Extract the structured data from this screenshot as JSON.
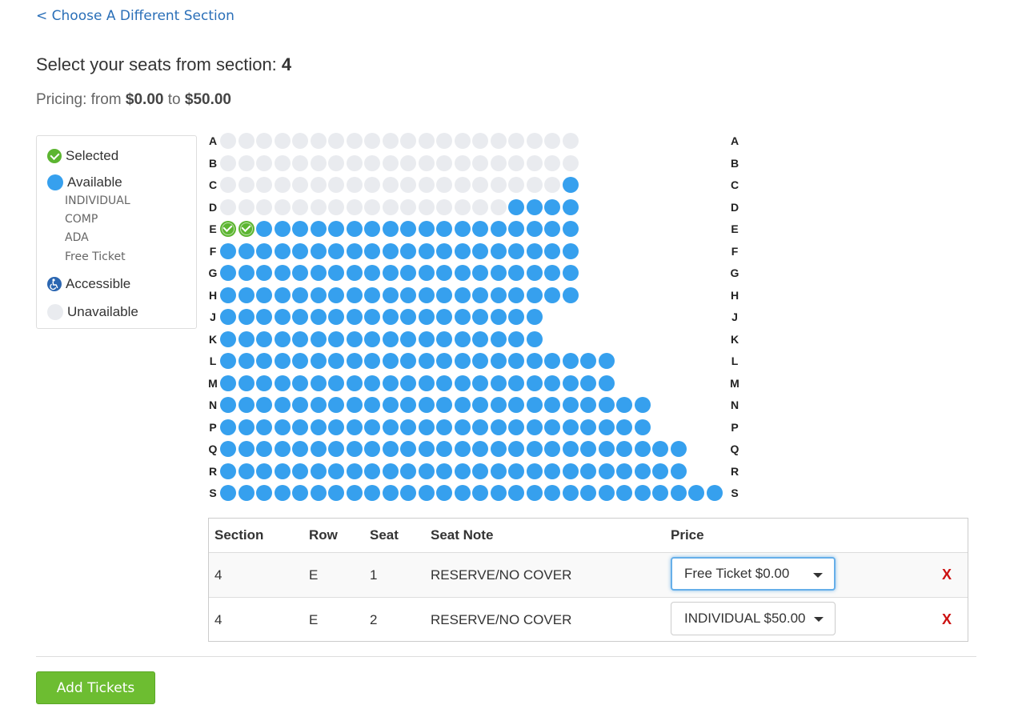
{
  "nav": {
    "back_link": "< Choose A Different Section"
  },
  "header": {
    "title_prefix": "Select your seats from section:",
    "section": "4",
    "pricing_prefix": "Pricing: from",
    "price_min": "$0.00",
    "pricing_mid": "to",
    "price_max": "$50.00"
  },
  "legend": {
    "selected": "Selected",
    "available": "Available",
    "price_levels": [
      "INDIVIDUAL",
      "COMP",
      "ADA",
      "Free Ticket"
    ],
    "accessible": "Accessible",
    "unavailable": "Unavailable"
  },
  "colors": {
    "available": "#36a0ee",
    "selected": "#5cb531",
    "unavailable": "#e9ebef",
    "accessible": "#2b66b1",
    "link": "#2a6fb8",
    "remove": "#cc1111",
    "add_button": "#6dbd31"
  },
  "seatmap": {
    "rows": [
      {
        "label": "A",
        "count": 20,
        "unavailable": 20,
        "selected": []
      },
      {
        "label": "B",
        "count": 20,
        "unavailable": 20,
        "selected": []
      },
      {
        "label": "C",
        "count": 20,
        "unavailable": 19,
        "selected": []
      },
      {
        "label": "D",
        "count": 20,
        "unavailable": 16,
        "selected": []
      },
      {
        "label": "E",
        "count": 20,
        "unavailable": 0,
        "selected": [
          1,
          2
        ]
      },
      {
        "label": "F",
        "count": 20,
        "unavailable": 0,
        "selected": []
      },
      {
        "label": "G",
        "count": 20,
        "unavailable": 0,
        "selected": []
      },
      {
        "label": "H",
        "count": 20,
        "unavailable": 0,
        "selected": []
      },
      {
        "label": "J",
        "count": 18,
        "unavailable": 0,
        "selected": []
      },
      {
        "label": "K",
        "count": 18,
        "unavailable": 0,
        "selected": []
      },
      {
        "label": "L",
        "count": 22,
        "unavailable": 0,
        "selected": []
      },
      {
        "label": "M",
        "count": 22,
        "unavailable": 0,
        "selected": []
      },
      {
        "label": "N",
        "count": 24,
        "unavailable": 0,
        "selected": []
      },
      {
        "label": "P",
        "count": 24,
        "unavailable": 0,
        "selected": []
      },
      {
        "label": "Q",
        "count": 26,
        "unavailable": 0,
        "selected": []
      },
      {
        "label": "R",
        "count": 26,
        "unavailable": 0,
        "selected": []
      },
      {
        "label": "S",
        "count": 28,
        "unavailable": 0,
        "selected": []
      }
    ]
  },
  "tickets": {
    "headers": {
      "section": "Section",
      "row": "Row",
      "seat": "Seat",
      "note": "Seat Note",
      "price": "Price"
    },
    "rows": [
      {
        "section": "4",
        "row": "E",
        "seat": "1",
        "note": "RESERVE/NO COVER",
        "price": "Free Ticket $0.00",
        "remove": "X"
      },
      {
        "section": "4",
        "row": "E",
        "seat": "2",
        "note": "RESERVE/NO COVER",
        "price": "INDIVIDUAL $50.00",
        "remove": "X"
      }
    ]
  },
  "actions": {
    "add_tickets": "Add Tickets"
  }
}
